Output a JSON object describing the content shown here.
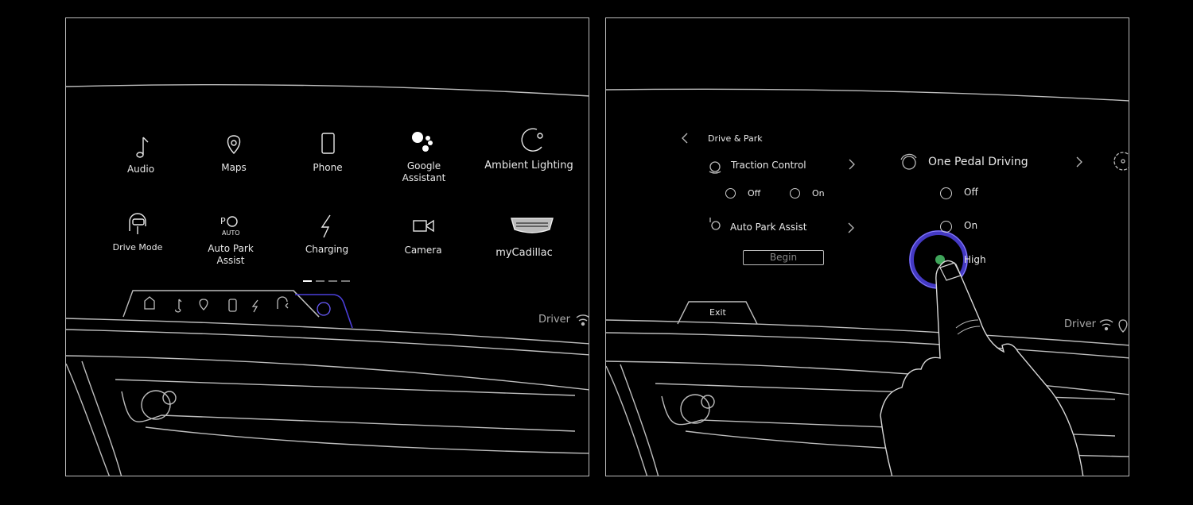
{
  "left_screen": {
    "apps": [
      {
        "label": "Audio",
        "icon": "music-note-icon"
      },
      {
        "label": "Maps",
        "icon": "map-pin-icon"
      },
      {
        "label": "Phone",
        "icon": "phone-icon"
      },
      {
        "label": "Google\nAssistant",
        "icon": "google-assistant-icon"
      },
      {
        "label": "Ambient Lighting",
        "icon": "ambient-lighting-icon"
      },
      {
        "label": "Drive Mode",
        "icon": "drive-mode-icon"
      },
      {
        "label": "Auto Park\nAssist",
        "icon": "auto-park-icon",
        "icon_text": "AUTO"
      },
      {
        "label": "Charging",
        "icon": "lightning-icon"
      },
      {
        "label": "Camera",
        "icon": "camera-icon"
      },
      {
        "label": "myCadillac",
        "icon": "cadillac-crest-icon"
      }
    ],
    "page_indicator": {
      "pages": 4,
      "current": 1
    },
    "dock": [
      "home-icon",
      "music-note-icon",
      "map-pin-icon",
      "phone-icon",
      "lightning-icon",
      "drive-mode-icon",
      "drive-park-icon"
    ],
    "dock_active": "drive-park-icon",
    "status": {
      "profile": "Driver",
      "icons": [
        "wifi-icon"
      ]
    }
  },
  "right_screen": {
    "header": {
      "back": "chevron-left-icon",
      "title": "Drive & Park"
    },
    "traction_control": {
      "label": "Traction Control",
      "options": [
        "Off",
        "On"
      ]
    },
    "auto_park_assist": {
      "label": "Auto Park Assist",
      "button": "Begin"
    },
    "one_pedal_driving": {
      "label": "One Pedal Driving",
      "options": [
        "Off",
        "On",
        "High"
      ],
      "selected": "High"
    },
    "exit_label": "Exit",
    "status": {
      "profile": "Driver",
      "icons": [
        "wifi-icon",
        "location-icon"
      ]
    }
  },
  "colors": {
    "accent": "#4b3fd9",
    "selected": "#3fa55a",
    "line": "#cfcfcf"
  }
}
